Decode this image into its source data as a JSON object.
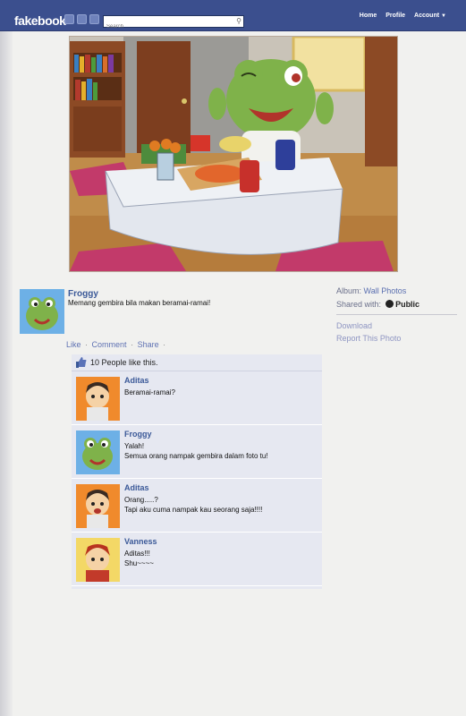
{
  "header": {
    "logo": "fakebook",
    "search_placeholder": "Search",
    "nav": {
      "home": "Home",
      "profile": "Profile",
      "account": "Account"
    }
  },
  "post": {
    "author": "Froggy",
    "text": "Memang gembira bila makan beramai-ramai!"
  },
  "sidebar": {
    "album_label": "Album:",
    "album_name": "Wall Photos",
    "shared_label": "Shared with:",
    "shared_value": "Public",
    "download": "Download",
    "report": "Report This Photo"
  },
  "actions": {
    "like": "Like",
    "comment": "Comment",
    "share": "Share",
    "separator": "·"
  },
  "likes": {
    "text": "10 People like this."
  },
  "comments": [
    {
      "name": "Aditas",
      "text": "Beramai-ramai?"
    },
    {
      "name": "Froggy",
      "text": "Yalah!\nSemua orang nampak gembira dalam foto tu!"
    },
    {
      "name": "Aditas",
      "text": "Orang.....?\nTapi aku cuma nampak kau seorang saja!!!!"
    },
    {
      "name": "Vanness",
      "text": "Aditas!!!\nShu~~~~"
    }
  ],
  "colors": {
    "topbar": "#3b4f8e",
    "link": "#3b5998",
    "comment_bg": "#e6e8f1",
    "avatar_froggy_bg": "#6db0e6",
    "avatar_aditas_bg": "#f08a2c",
    "avatar_vanness_bg": "#f3d866"
  },
  "icons": {
    "search": "search-icon",
    "globe": "globe-icon",
    "thumb": "thumbs-up-icon",
    "chevron": "chevron-down-icon"
  }
}
